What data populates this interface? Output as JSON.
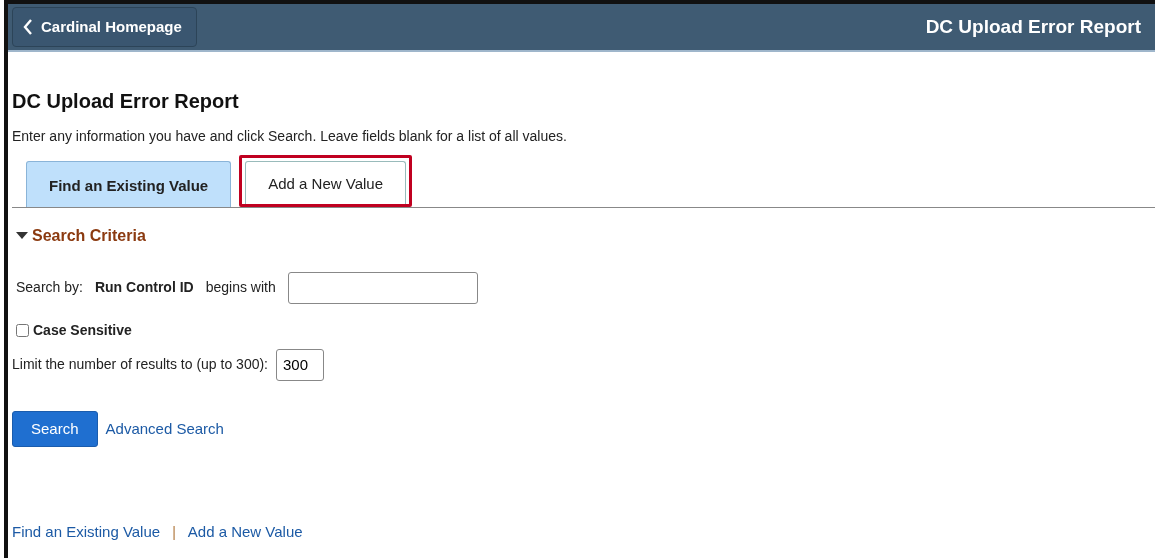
{
  "header": {
    "back_label": "Cardinal Homepage",
    "title": "DC Upload Error Report"
  },
  "page_title": "DC Upload Error Report",
  "instructions": "Enter any information you have and click Search. Leave fields blank for a list of all values.",
  "tabs": [
    {
      "label": "Find an Existing Value",
      "selected": true,
      "highlighted": false
    },
    {
      "label": "Add a New Value",
      "selected": false,
      "highlighted": true
    }
  ],
  "section": {
    "title": "Search Criteria",
    "expanded": true
  },
  "search_by": {
    "label": "Search by:",
    "field": "Run Control ID",
    "operator": "begins with"
  },
  "case_sensitive": {
    "label": "Case Sensitive",
    "checked": false
  },
  "limit": {
    "label": "Limit the number of results to (up to 300):",
    "value": "300"
  },
  "search_button": "Search",
  "advanced_link": "Advanced Search",
  "footer_links": [
    "Find an Existing Value",
    "Add a New Value"
  ],
  "footer_separator": "|"
}
